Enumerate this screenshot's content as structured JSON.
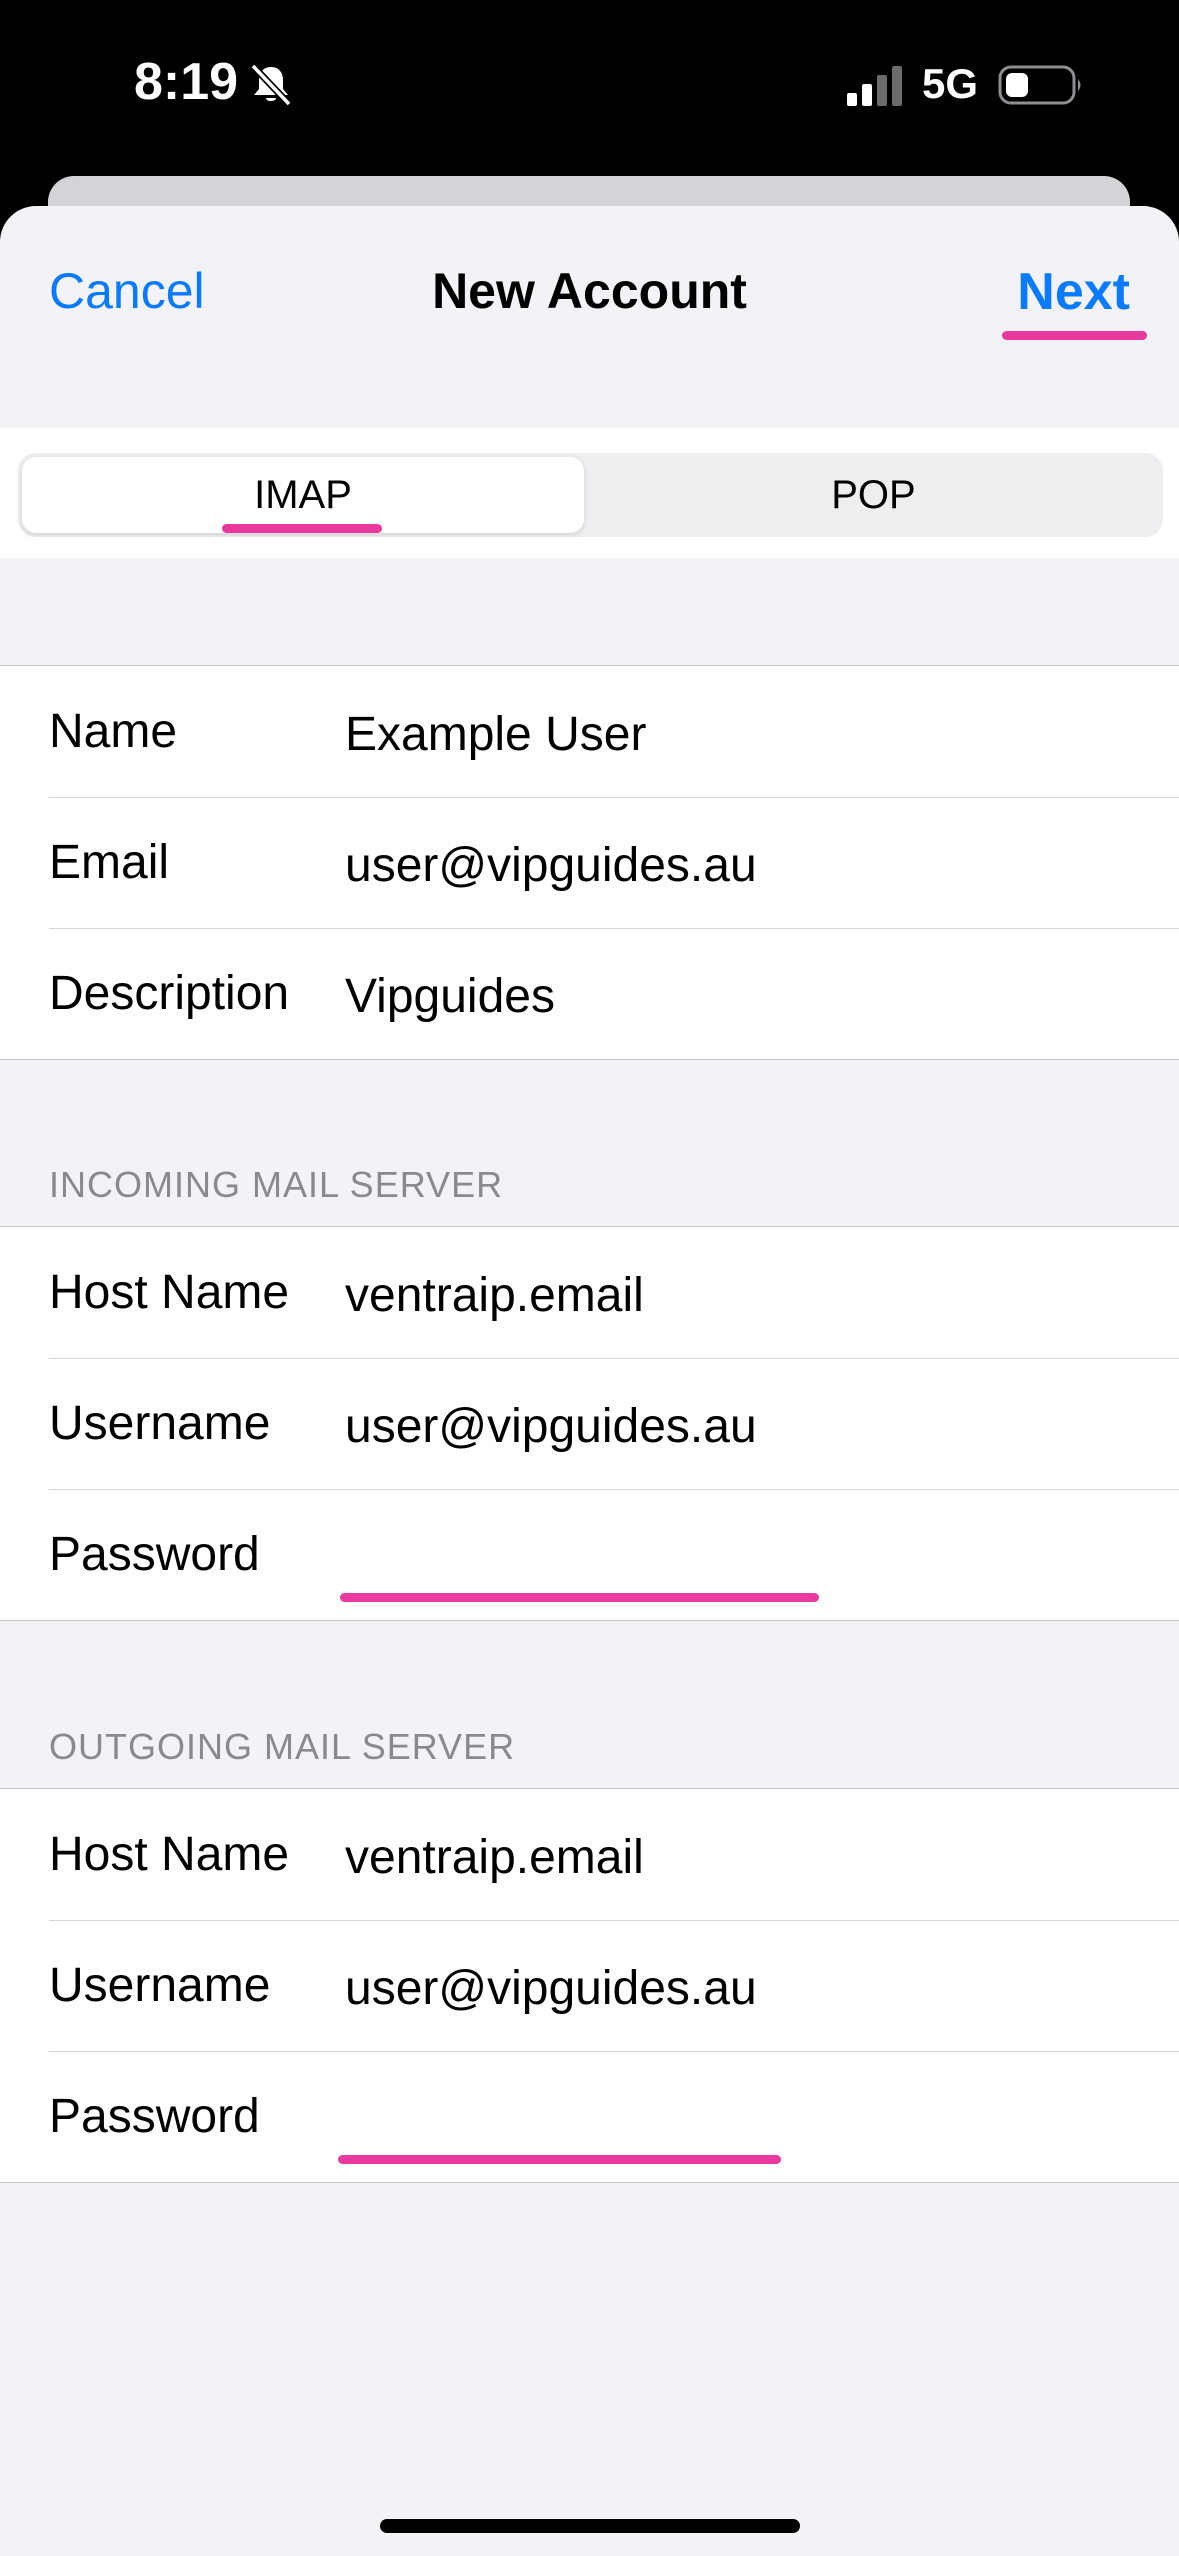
{
  "status_bar": {
    "time": "8:19",
    "network": "5G",
    "icons": [
      "bell-slash-icon",
      "cellular-signal-icon",
      "battery-icon"
    ]
  },
  "nav": {
    "cancel_label": "Cancel",
    "title": "New Account",
    "next_label": "Next"
  },
  "segmented": {
    "options": [
      "IMAP",
      "POP"
    ],
    "selected": "IMAP"
  },
  "account": {
    "rows": [
      {
        "label": "Name",
        "value": "Example User"
      },
      {
        "label": "Email",
        "value": "user@vipguides.au"
      },
      {
        "label": "Description",
        "value": "Vipguides"
      }
    ]
  },
  "incoming": {
    "header": "INCOMING MAIL SERVER",
    "rows": [
      {
        "label": "Host Name",
        "value": "ventraip.email"
      },
      {
        "label": "Username",
        "value": "user@vipguides.au"
      },
      {
        "label": "Password",
        "value": ""
      }
    ]
  },
  "outgoing": {
    "header": "OUTGOING MAIL SERVER",
    "rows": [
      {
        "label": "Host Name",
        "value": "ventraip.email"
      },
      {
        "label": "Username",
        "value": "user@vipguides.au"
      },
      {
        "label": "Password",
        "value": ""
      }
    ]
  },
  "colors": {
    "accent": "#0a7aff",
    "annotation": "#e8399e",
    "background": "#f2f2f7",
    "section_header": "#8a8a8e"
  }
}
